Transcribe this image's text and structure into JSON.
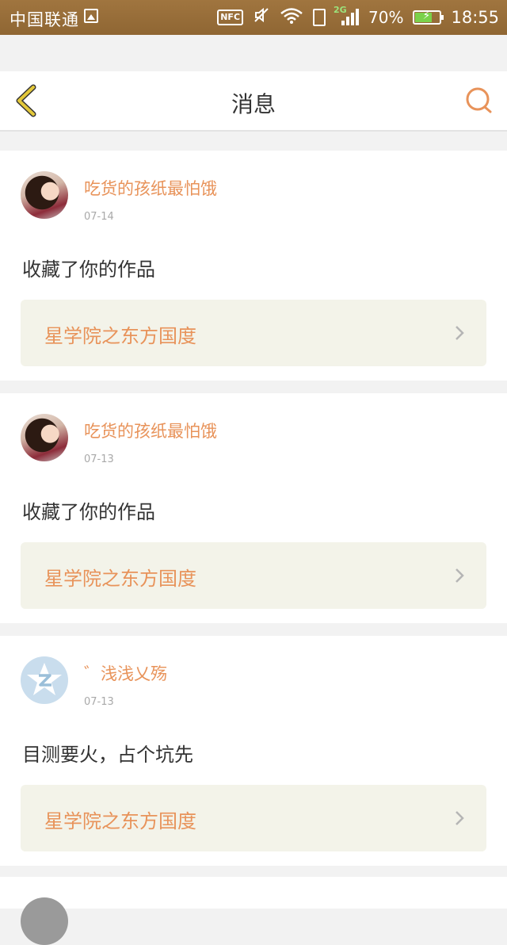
{
  "status_bar": {
    "carrier": "中国联通",
    "nfc": "NFC",
    "network": "2G",
    "signal_bars": 4,
    "battery_percent": "70%",
    "battery_level": 0.7,
    "time": "18:55"
  },
  "header": {
    "title": "消息"
  },
  "colors": {
    "accent": "#e8935a",
    "back_icon": "#e3c83a",
    "link_background": "#f3f3e9"
  },
  "messages": [
    {
      "user": "吃货的孩纸最怕饿",
      "date": "07-14",
      "avatar": "photo",
      "text": "收藏了你的作品",
      "work": "星学院之东方国度"
    },
    {
      "user": "吃货的孩纸最怕饿",
      "date": "07-13",
      "avatar": "photo",
      "text": "收藏了你的作品",
      "work": "星学院之东方国度"
    },
    {
      "user": "゛浅浅乂殇",
      "date": "07-13",
      "avatar": "default-qq",
      "text": "目测要火，占个坑先",
      "work": "星学院之东方国度"
    }
  ]
}
